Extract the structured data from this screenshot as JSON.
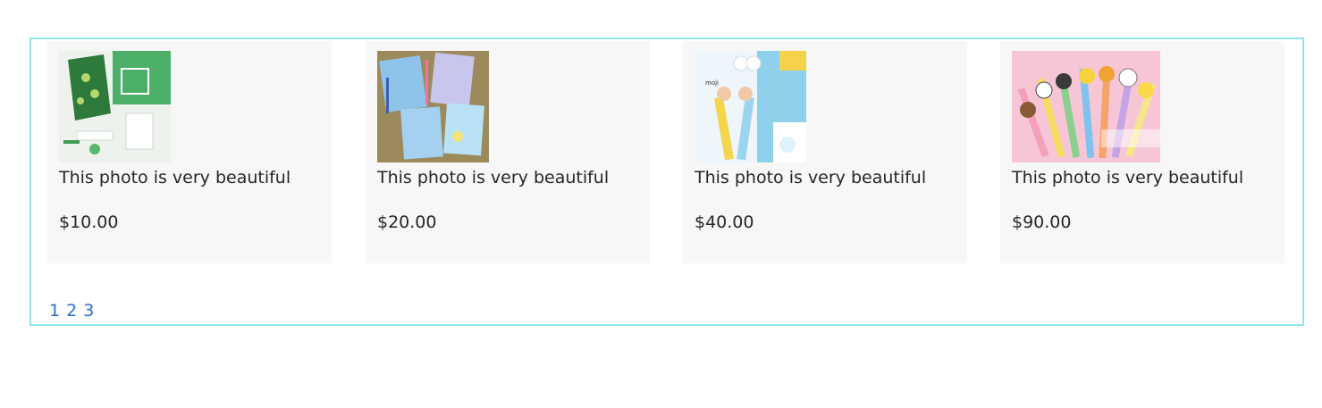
{
  "products": [
    {
      "caption": "This photo is very beautiful",
      "price": "$10.00",
      "image": "green-stationery-photo"
    },
    {
      "caption": "This photo is very beautiful",
      "price": "$20.00",
      "image": "blue-notebooks-photo"
    },
    {
      "caption": "This photo is very beautiful",
      "price": "$40.00",
      "image": "multicolor-pens-photo"
    },
    {
      "caption": "This photo is very beautiful",
      "price": "$90.00",
      "image": "character-pens-photo"
    }
  ],
  "pagination": {
    "pages": [
      "1",
      "2",
      "3"
    ]
  },
  "colors": {
    "frame_border": "#90e4ee",
    "card_bg": "#f7f7f7",
    "link": "#2a6fd6"
  }
}
